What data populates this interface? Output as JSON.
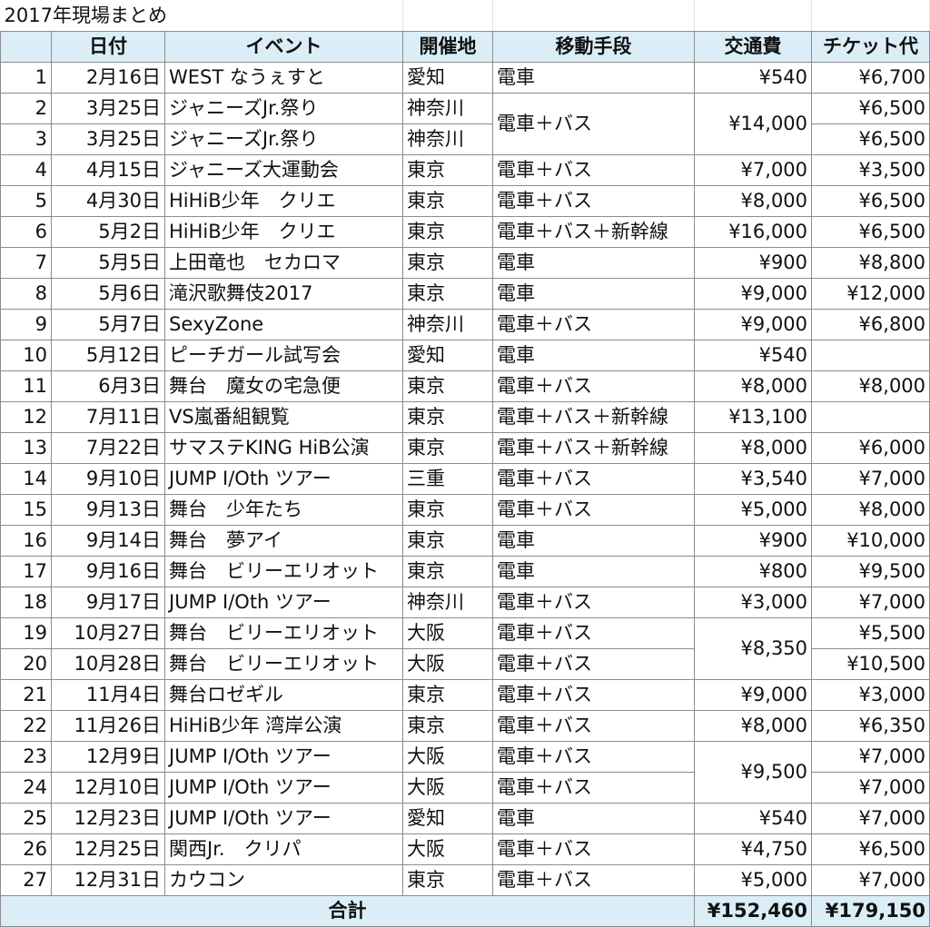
{
  "title": "2017年現場まとめ",
  "headers": [
    "",
    "日付",
    "イベント",
    "開催地",
    "移動手段",
    "交通費",
    "チケット代"
  ],
  "rows": [
    {
      "no": "1",
      "date": "2月16日",
      "event": "WEST なうぇすと",
      "place": "愛知",
      "transport": "電車",
      "fare": "¥540",
      "ticket": "¥6,700"
    },
    {
      "no": "2",
      "date": "3月25日",
      "event": "ジャニーズJr.祭り",
      "place": "神奈川",
      "transport": "電車＋バス",
      "fare": "¥14,000",
      "ticket": "¥6,500"
    },
    {
      "no": "3",
      "date": "3月25日",
      "event": "ジャニーズJr.祭り",
      "place": "神奈川",
      "transport": "",
      "fare": "",
      "ticket": "¥6,500"
    },
    {
      "no": "4",
      "date": "4月15日",
      "event": "ジャニーズ大運動会",
      "place": "東京",
      "transport": "電車＋バス",
      "fare": "¥7,000",
      "ticket": "¥3,500"
    },
    {
      "no": "5",
      "date": "4月30日",
      "event": "HiHiB少年　クリエ",
      "place": "東京",
      "transport": "電車＋バス",
      "fare": "¥8,000",
      "ticket": "¥6,500"
    },
    {
      "no": "6",
      "date": "5月2日",
      "event": "HiHiB少年　クリエ",
      "place": "東京",
      "transport": "電車＋バス＋新幹線",
      "fare": "¥16,000",
      "ticket": "¥6,500"
    },
    {
      "no": "7",
      "date": "5月5日",
      "event": "上田竜也　セカロマ",
      "place": "東京",
      "transport": "電車",
      "fare": "¥900",
      "ticket": "¥8,800"
    },
    {
      "no": "8",
      "date": "5月6日",
      "event": "滝沢歌舞伎2017",
      "place": "東京",
      "transport": "電車",
      "fare": "¥9,000",
      "ticket": "¥12,000"
    },
    {
      "no": "9",
      "date": "5月7日",
      "event": "SexyZone",
      "place": "神奈川",
      "transport": "電車＋バス",
      "fare": "¥9,000",
      "ticket": "¥6,800"
    },
    {
      "no": "10",
      "date": "5月12日",
      "event": "ピーチガール試写会",
      "place": "愛知",
      "transport": "電車",
      "fare": "¥540",
      "ticket": ""
    },
    {
      "no": "11",
      "date": "6月3日",
      "event": "舞台　魔女の宅急便",
      "place": "東京",
      "transport": "電車＋バス",
      "fare": "¥8,000",
      "ticket": "¥8,000"
    },
    {
      "no": "12",
      "date": "7月11日",
      "event": "VS嵐番組観覧",
      "place": "東京",
      "transport": "電車＋バス＋新幹線",
      "fare": "¥13,100",
      "ticket": ""
    },
    {
      "no": "13",
      "date": "7月22日",
      "event": "サマステKING HiB公演",
      "place": "東京",
      "transport": "電車＋バス＋新幹線",
      "fare": "¥8,000",
      "ticket": "¥6,000"
    },
    {
      "no": "14",
      "date": "9月10日",
      "event": "JUMP I/Oth ツアー",
      "place": "三重",
      "transport": "電車＋バス",
      "fare": "¥3,540",
      "ticket": "¥7,000"
    },
    {
      "no": "15",
      "date": "9月13日",
      "event": "舞台　少年たち",
      "place": "東京",
      "transport": "電車＋バス",
      "fare": "¥5,000",
      "ticket": "¥8,000"
    },
    {
      "no": "16",
      "date": "9月14日",
      "event": "舞台　夢アイ",
      "place": "東京",
      "transport": "電車",
      "fare": "¥900",
      "ticket": "¥10,000"
    },
    {
      "no": "17",
      "date": "9月16日",
      "event": "舞台　ビリーエリオット",
      "place": "東京",
      "transport": "電車",
      "fare": "¥800",
      "ticket": "¥9,500"
    },
    {
      "no": "18",
      "date": "9月17日",
      "event": "JUMP I/Oth ツアー",
      "place": "神奈川",
      "transport": "電車＋バス",
      "fare": "¥3,000",
      "ticket": "¥7,000"
    },
    {
      "no": "19",
      "date": "10月27日",
      "event": "舞台　ビリーエリオット",
      "place": "大阪",
      "transport": "電車＋バス",
      "fare": "¥8,350",
      "ticket": "¥5,500"
    },
    {
      "no": "20",
      "date": "10月28日",
      "event": "舞台　ビリーエリオット",
      "place": "大阪",
      "transport": "電車＋バス",
      "fare": "",
      "ticket": "¥10,500"
    },
    {
      "no": "21",
      "date": "11月4日",
      "event": "舞台ロゼギル",
      "place": "東京",
      "transport": "電車＋バス",
      "fare": "¥9,000",
      "ticket": "¥3,000"
    },
    {
      "no": "22",
      "date": "11月26日",
      "event": "HiHiB少年 湾岸公演",
      "place": "東京",
      "transport": "電車＋バス",
      "fare": "¥8,000",
      "ticket": "¥6,350"
    },
    {
      "no": "23",
      "date": "12月9日",
      "event": "JUMP I/Oth ツアー",
      "place": "大阪",
      "transport": "電車＋バス",
      "fare": "¥9,500",
      "ticket": "¥7,000"
    },
    {
      "no": "24",
      "date": "12月10日",
      "event": "JUMP I/Oth ツアー",
      "place": "大阪",
      "transport": "電車＋バス",
      "fare": "",
      "ticket": "¥7,000"
    },
    {
      "no": "25",
      "date": "12月23日",
      "event": "JUMP I/Oth ツアー",
      "place": "愛知",
      "transport": "電車",
      "fare": "¥540",
      "ticket": "¥7,000"
    },
    {
      "no": "26",
      "date": "12月25日",
      "event": "関西Jr.　クリパ",
      "place": "大阪",
      "transport": "電車＋バス",
      "fare": "¥4,750",
      "ticket": "¥6,500"
    },
    {
      "no": "27",
      "date": "12月31日",
      "event": "カウコン",
      "place": "東京",
      "transport": "電車＋バス",
      "fare": "¥5,000",
      "ticket": "¥7,000"
    }
  ],
  "footer": {
    "label": "合計",
    "fare_total": "¥152,460",
    "ticket_total": "¥179,150"
  }
}
